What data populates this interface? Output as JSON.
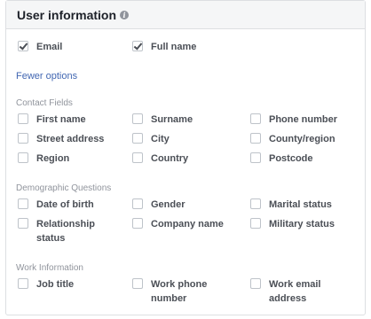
{
  "header": {
    "title": "User information",
    "info_icon": "info-icon"
  },
  "basic": [
    {
      "label": "Email",
      "checked": true
    },
    {
      "label": "Full name",
      "checked": true
    }
  ],
  "fewer_options": "Fewer options",
  "sections": [
    {
      "title": "Contact Fields",
      "items": [
        "First name",
        "Surname",
        "Phone number",
        "Street address",
        "City",
        "County/region",
        "Region",
        "Country",
        "Postcode"
      ]
    },
    {
      "title": "Demographic Questions",
      "items": [
        "Date of birth",
        "Gender",
        "Marital status",
        "Relationship status",
        "Company name",
        "Military status"
      ]
    },
    {
      "title": "Work Information",
      "items": [
        "Job title",
        "Work phone number",
        "Work email address"
      ]
    }
  ]
}
